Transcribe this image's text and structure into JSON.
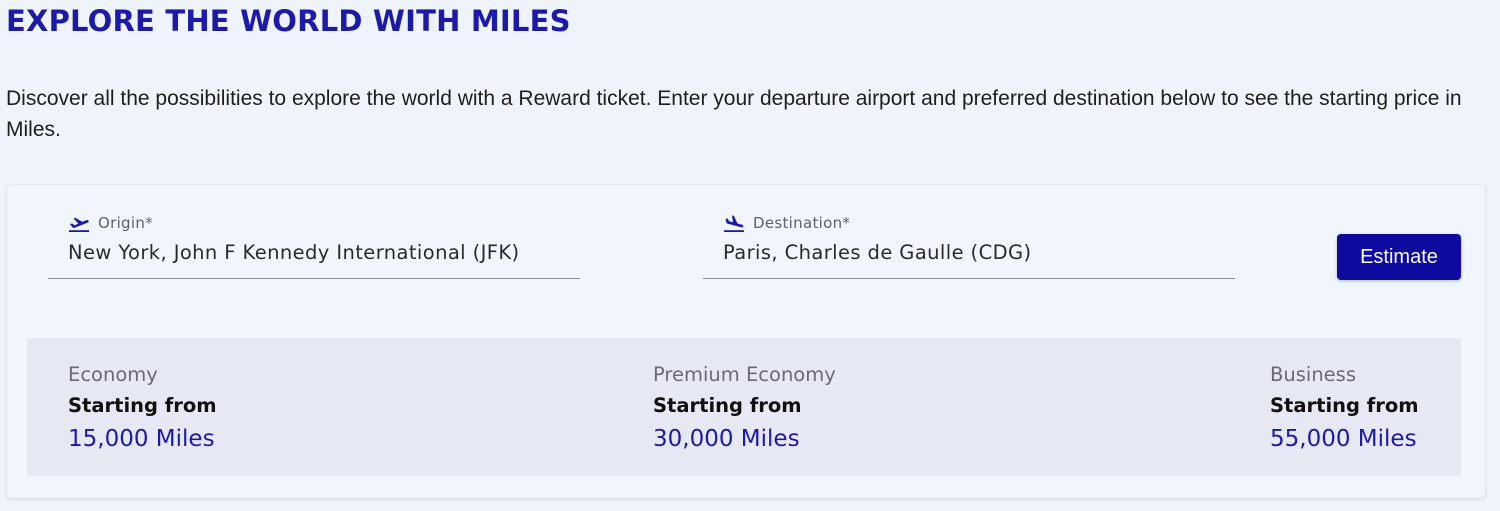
{
  "header": {
    "title": "EXPLORE THE WORLD WITH MILES",
    "intro": "Discover all the possibilities to explore the world with a Reward ticket. Enter your departure airport and preferred destination below to see the starting price in Miles."
  },
  "search": {
    "origin": {
      "label": "Origin*",
      "value": "New York, John F Kennedy International (JFK)",
      "icon": "plane-takeoff-icon"
    },
    "destination": {
      "label": "Destination*",
      "value": "Paris, Charles de Gaulle (CDG)",
      "icon": "plane-landing-icon"
    },
    "estimate_label": "Estimate"
  },
  "results": [
    {
      "cabin": "Economy",
      "caption": "Starting from",
      "miles": "15,000 Miles"
    },
    {
      "cabin": "Premium Economy",
      "caption": "Starting from",
      "miles": "30,000 Miles"
    },
    {
      "cabin": "Business",
      "caption": "Starting from",
      "miles": "55,000 Miles"
    }
  ],
  "colors": {
    "accent": "#1c1aa8",
    "button": "#0e0aa0",
    "page_background": "#eff3fc",
    "results_background": "#e6e8f4"
  }
}
